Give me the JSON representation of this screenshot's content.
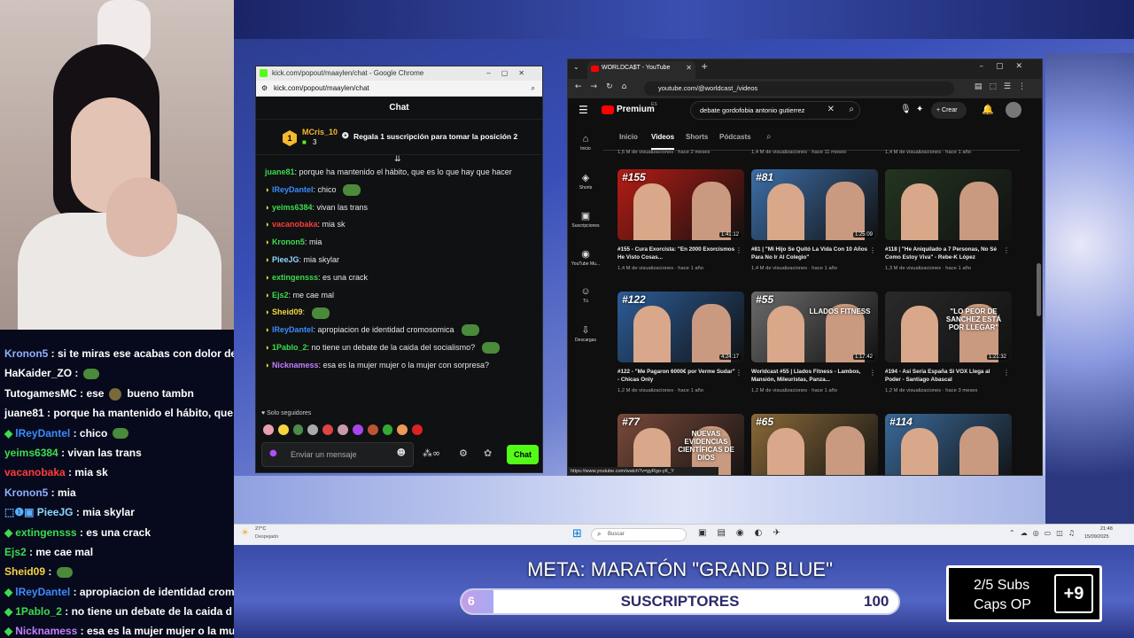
{
  "webcam": {},
  "stream_chat": [
    {
      "name": "",
      "msg": "",
      "partial": true
    },
    {
      "name": "Kronon5",
      "msg": " : si te miras ese acabas con dolor de",
      "color": "#8fb0ff"
    },
    {
      "name": "HaKaider_ZO",
      "msg": " :",
      "color": "#ffffff",
      "emote": true
    },
    {
      "name": "TutogamesMC",
      "msg": " : ese",
      "color": "#ffffff",
      "tail": "bueno tambn"
    },
    {
      "name": "juane81",
      "msg": " : porque ha mantenido el hábito, que",
      "color": "#ffffff"
    },
    {
      "name": "lReyDantel",
      "msg": " : chico",
      "color": "#3d8bff",
      "badge": true,
      "emote": true
    },
    {
      "name": "yeims6384",
      "msg": " : vivan las trans",
      "color": "#3ddc4d"
    },
    {
      "name": "vacanobaka",
      "msg": " : mia sk",
      "color": "#ff3b3b"
    },
    {
      "name": "Kronon5",
      "msg": " : mia",
      "color": "#8fb0ff"
    },
    {
      "name": "PieeJG",
      "msg": " : mia skylar",
      "color": "#8fd8ff",
      "badges3": true
    },
    {
      "name": "extingensss",
      "msg": " : es una crack",
      "color": "#3ddc4d",
      "badge": true
    },
    {
      "name": "Ejs2",
      "msg": " : me cae mal",
      "color": "#3ddc4d"
    },
    {
      "name": "Sheid09",
      "msg": " :",
      "color": "#f5d442",
      "emote": true
    },
    {
      "name": "lReyDantel",
      "msg": " : apropiacion de identidad crom",
      "color": "#3d8bff",
      "badge": true
    },
    {
      "name": "1Pablo_2",
      "msg": " : no tiene un debate de la caida d",
      "color": "#3ddc4d",
      "badge": true
    },
    {
      "name": "Nicknamess",
      "msg": " : esa es la mujer mujer o la mu",
      "color": "#c07fff",
      "badge": true
    }
  ],
  "kick_window": {
    "title": "kick.com/popout/maaylen/chat - Google Chrome",
    "url": "kick.com/popout/maaylen/chat",
    "header": "Chat",
    "pinned_user": "MCris_10",
    "pinned_count": "3",
    "pinned_msg": "Regala 1 suscripción para tomar la posición 2",
    "messages": [
      {
        "n": "juane81",
        "t": ": porque ha mantenido el hábito, que es lo que hay que hacer",
        "c": "#3ddc4d"
      },
      {
        "n": "lReyDantel",
        "t": ": chico",
        "c": "#3d8bff"
      },
      {
        "n": "yeims6384",
        "t": ": vivan las trans",
        "c": "#3ddc4d"
      },
      {
        "n": "vacanobaka",
        "t": ": mia sk",
        "c": "#ff3b3b"
      },
      {
        "n": "Kronon5",
        "t": ": mia",
        "c": "#3ddc4d"
      },
      {
        "n": "PieeJG",
        "t": ": mia skylar",
        "c": "#8fd8ff"
      },
      {
        "n": "extingensss",
        "t": ": es una crack",
        "c": "#3ddc4d"
      },
      {
        "n": "Ejs2",
        "t": ": me cae mal",
        "c": "#3ddc4d"
      },
      {
        "n": "Sheid09",
        "t": ":",
        "c": "#f5d442"
      },
      {
        "n": "lReyDantel",
        "t": ": apropiacion de identidad cromosomica",
        "c": "#3d8bff"
      },
      {
        "n": "1Pablo_2",
        "t": ": no tiene un debate de la caida del socialismo?",
        "c": "#3ddc4d"
      },
      {
        "n": "Nicknamess",
        "t": ": esa es la mujer mujer o la mujer con sorpresa?",
        "c": "#c07fff"
      }
    ],
    "followers_only": "Solo seguidores",
    "input_placeholder": "Enviar un mensaje",
    "chat_button": "Chat"
  },
  "youtube_window": {
    "tab_title": "WORLDCA$T - YouTube",
    "url": "youtube.com/@worldcast_/videos",
    "logo": "Premium",
    "logo_sup": "ES",
    "search_value": "debate gordofobia antonio gutierrez",
    "create": "Crear",
    "channel_tabs": [
      "Inicio",
      "Videos",
      "Shorts",
      "Pódcasts"
    ],
    "sidebar": [
      "Inicio",
      "Shorts",
      "Suscripciones",
      "YouTube Mu...",
      "Tú",
      "Descargas"
    ],
    "top_row_meta": [
      "1,5 M de visualizaciones · hace 2 meses",
      "1,4 M de visualizaciones · hace 11 meses",
      "1,4 M de visualizaciones · hace 1 año"
    ],
    "videos": [
      {
        "num": "#155",
        "dur": "1:41:12",
        "title": "#155 - Cura Exorcista: \"En 2000 Exorcismos He Visto Cosas...",
        "meta": "1,4 M de visualizaciones · hace 1 año",
        "bg": "#b51c14"
      },
      {
        "num": "#81",
        "dur": "1:25:09",
        "title": "#81 | \"Mi Hijo Se Quitó La Vida Con 10 Años Para No Ir Al Colegio\"",
        "meta": "1,4 M de visualizaciones · hace 1 año",
        "bg": "#3d6fa8"
      },
      {
        "num": "",
        "dur": "",
        "title": "#118 | \"He Aniquilado a 7 Personas, No Sé Como Estoy Viva\" - Rebe-K López",
        "meta": "1,3 M de visualizaciones · hace 1 año",
        "bg": "#243521"
      },
      {
        "num": "#122",
        "dur": "4:24:17",
        "title": "#122 - \"Me Pagaron 6000€ por Verme Sudar\" - Chicas Only",
        "meta": "1,2 M de visualizaciones · hace 1 año",
        "bg": "#2c5d99"
      },
      {
        "num": "#55",
        "dur": "1:17:42",
        "title": "Worldcast #55 | Llados Fitness - Lambos, Mansión, Mileuristas, Panza...",
        "meta": "1,2 M de visualizaciones · hace 1 año",
        "bg": "#6b6b6b",
        "overlay": "LLADOS FITNESS"
      },
      {
        "num": "",
        "dur": "1:21:32",
        "title": "#194 - Así Sería España Si VOX Llega al Poder - Santiago Abascal",
        "meta": "1,2 M de visualizaciones · hace 3 meses",
        "bg": "#2a2a2a",
        "overlay": "\"LO PEOR DE SANCHEZ ESTÁ POR LLEGAR\""
      },
      {
        "num": "#77",
        "dur": "",
        "title": "",
        "meta": "",
        "bg": "#7a4a3a",
        "overlay": "NUEVAS EVIDENCIAS CIENTÍFICAS DE DIOS"
      },
      {
        "num": "#65",
        "dur": "",
        "title": "",
        "meta": "",
        "bg": "#8a6a3a"
      },
      {
        "num": "#114",
        "dur": "",
        "title": "",
        "meta": "",
        "bg": "#3a6a9a"
      }
    ],
    "status_url": "https://www.youtube.com/watch?v=gyRgo-yK_Y"
  },
  "taskbar": {
    "weather_temp": "27°C",
    "weather_desc": "Despejado",
    "search": "Buscar",
    "time": "21:48",
    "date": "15/09/2025"
  },
  "goal": {
    "title": "META: MARATÓN \"GRAND BLUE\"",
    "current": "6",
    "label": "SUSCRIPTORES",
    "target": "100",
    "progress_fraction": 0.06
  },
  "subs_box": {
    "line1": "2/5 Subs",
    "line2": "Caps OP",
    "plus": "+9"
  }
}
